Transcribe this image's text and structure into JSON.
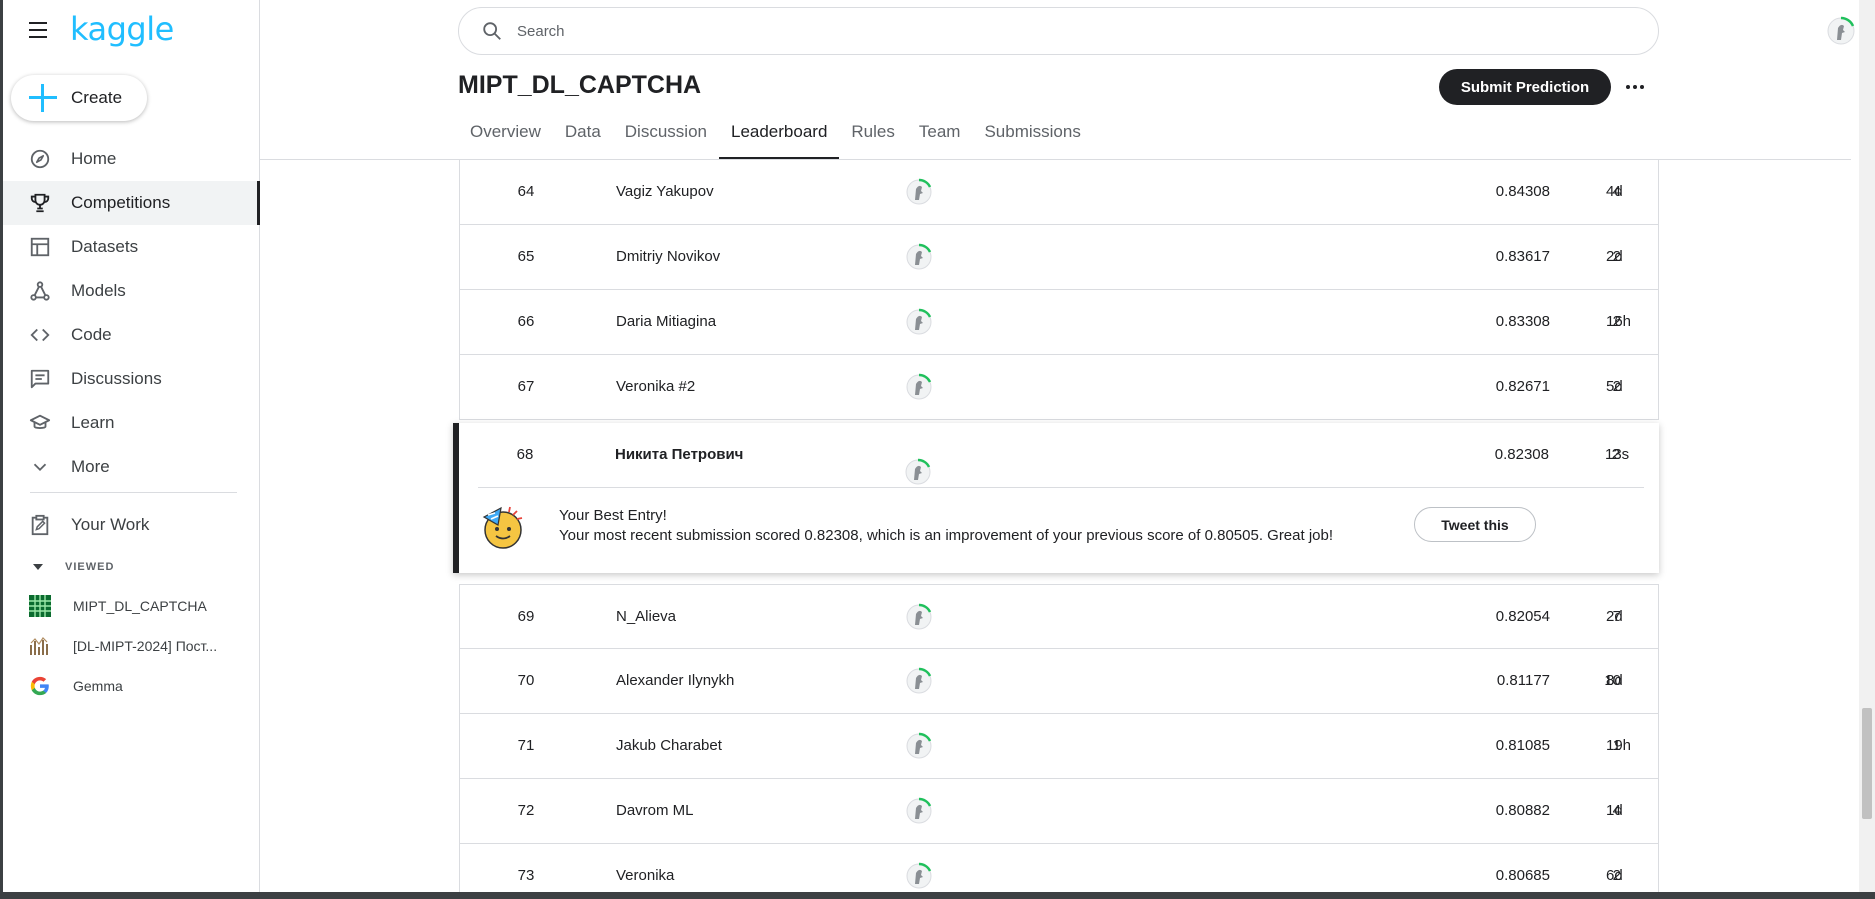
{
  "brand": {
    "logo_text": "kaggle",
    "accent": "#20beff"
  },
  "sidebar": {
    "create_label": "Create",
    "items": [
      {
        "label": "Home",
        "icon": "compass-icon"
      },
      {
        "label": "Competitions",
        "icon": "trophy-icon",
        "active": true
      },
      {
        "label": "Datasets",
        "icon": "table-icon"
      },
      {
        "label": "Models",
        "icon": "models-icon"
      },
      {
        "label": "Code",
        "icon": "code-icon"
      },
      {
        "label": "Discussions",
        "icon": "discussion-icon"
      },
      {
        "label": "Learn",
        "icon": "graduation-cap-icon"
      },
      {
        "label": "More",
        "icon": "chevron-down-icon"
      }
    ],
    "your_work": "Your Work",
    "viewed_label": "VIEWED",
    "viewed": [
      {
        "label": "MIPT_DL_CAPTCHA"
      },
      {
        "label": "[DL-MIPT-2024] Пост..."
      },
      {
        "label": "Gemma"
      }
    ]
  },
  "header": {
    "search_placeholder": "Search"
  },
  "competition": {
    "title": "MIPT_DL_CAPTCHA",
    "submit_label": "Submit Prediction",
    "tabs": [
      "Overview",
      "Data",
      "Discussion",
      "Leaderboard",
      "Rules",
      "Team",
      "Submissions"
    ],
    "active_tab": "Leaderboard"
  },
  "leaderboard": {
    "rows_before": [
      {
        "rank": "64",
        "team": "Vagiz Yakupov",
        "score": "0.84308",
        "entries": "4",
        "last": "4d"
      },
      {
        "rank": "65",
        "team": "Dmitriy Novikov",
        "score": "0.83617",
        "entries": "2",
        "last": "2d"
      },
      {
        "rank": "66",
        "team": "Daria Mitiagina",
        "score": "0.83308",
        "entries": "2",
        "last": "16h"
      },
      {
        "rank": "67",
        "team": "Veronika #2",
        "score": "0.82671",
        "entries": "2",
        "last": "5d"
      }
    ],
    "my_row": {
      "rank": "68",
      "team": "Никита Петрович",
      "score": "0.82308",
      "entries": "2",
      "last": "13s"
    },
    "best_entry": {
      "title": "Your Best Entry!",
      "message": "Your most recent submission scored 0.82308, which is an improvement of your previous score of 0.80505. Great job!",
      "tweet_label": "Tweet this"
    },
    "rows_after": [
      {
        "rank": "69",
        "team": "N_Alieva",
        "score": "0.82054",
        "entries": "7",
        "last": "2d"
      },
      {
        "rank": "70",
        "team": "Alexander Ilynykh",
        "score": "0.81177",
        "entries": "10",
        "last": "8d"
      },
      {
        "rank": "71",
        "team": "Jakub Charabet",
        "score": "0.81085",
        "entries": "1",
        "last": "19h"
      },
      {
        "rank": "72",
        "team": "Davrom ML",
        "score": "0.80882",
        "entries": "4",
        "last": "1d"
      },
      {
        "rank": "73",
        "team": "Veronika",
        "score": "0.80685",
        "entries": "2",
        "last": "6d"
      }
    ]
  }
}
